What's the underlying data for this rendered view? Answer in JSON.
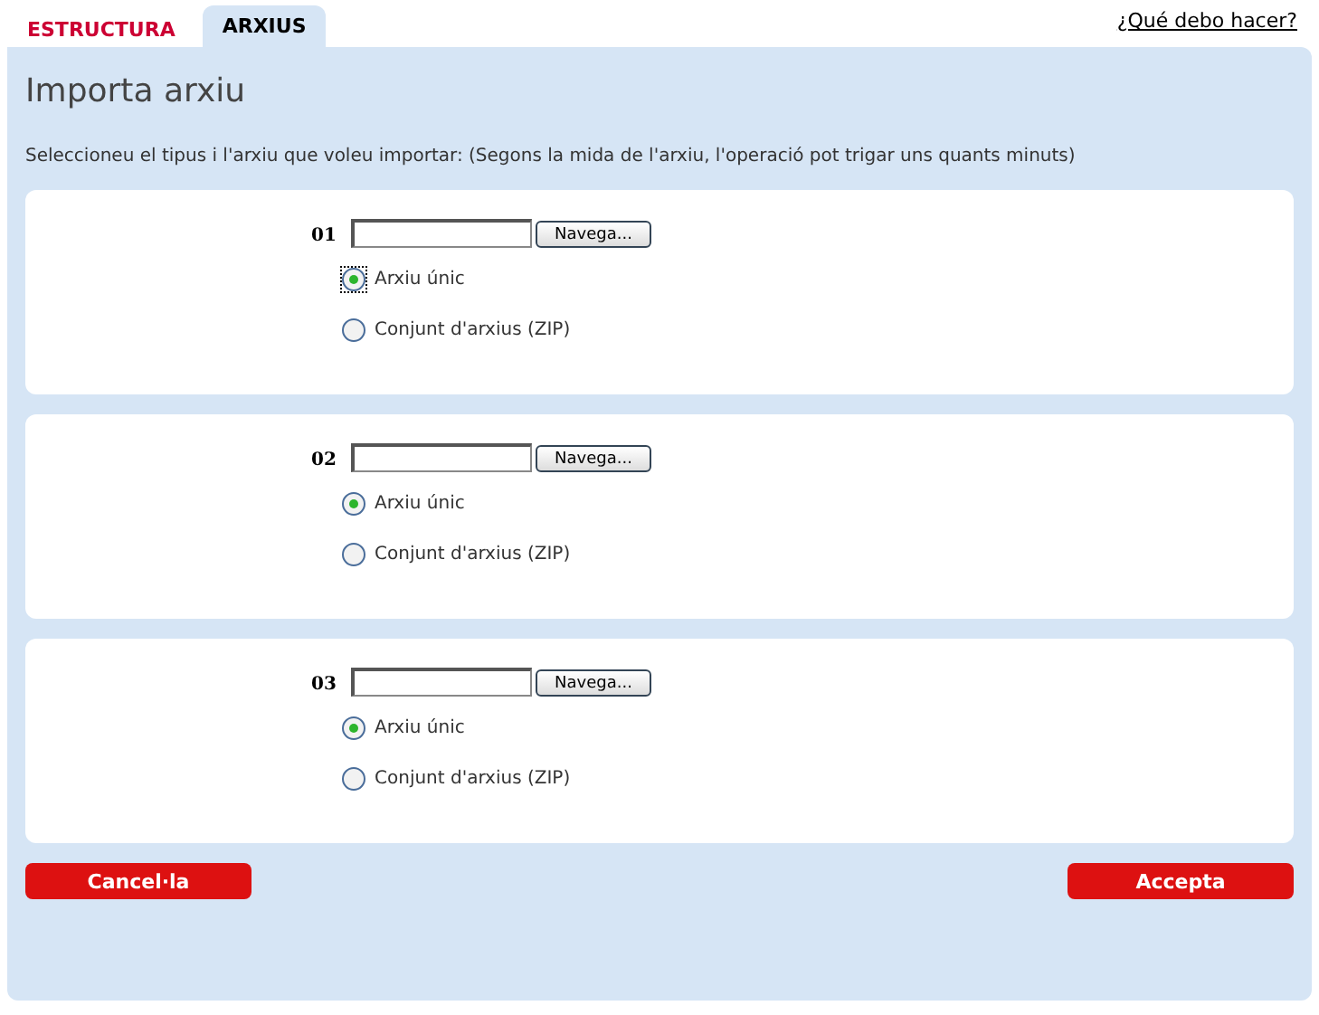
{
  "tabs": [
    {
      "label": "ESTRUCTURA",
      "selected": false
    },
    {
      "label": "ARXIUS",
      "selected": true
    }
  ],
  "help_link": "¿Qué debo hacer?",
  "title": "Importa arxiu",
  "instructions": "Seleccioneu el tipus i l'arxiu que voleu importar: (Segons la mida de l'arxiu, l'operació pot trigar uns quants minuts)",
  "files": [
    {
      "number": "01",
      "browse": "Navega...",
      "options": [
        {
          "label": "Arxiu únic",
          "selected": true,
          "focused": true
        },
        {
          "label": "Conjunt d'arxius (ZIP)",
          "selected": false,
          "focused": false
        }
      ]
    },
    {
      "number": "02",
      "browse": "Navega...",
      "options": [
        {
          "label": "Arxiu únic",
          "selected": true,
          "focused": false
        },
        {
          "label": "Conjunt d'arxius (ZIP)",
          "selected": false,
          "focused": false
        }
      ]
    },
    {
      "number": "03",
      "browse": "Navega...",
      "options": [
        {
          "label": "Arxiu únic",
          "selected": true,
          "focused": false
        },
        {
          "label": "Conjunt d'arxius (ZIP)",
          "selected": false,
          "focused": false
        }
      ]
    }
  ],
  "buttons": {
    "cancel": "Cancel·la",
    "accept": "Accepta"
  }
}
